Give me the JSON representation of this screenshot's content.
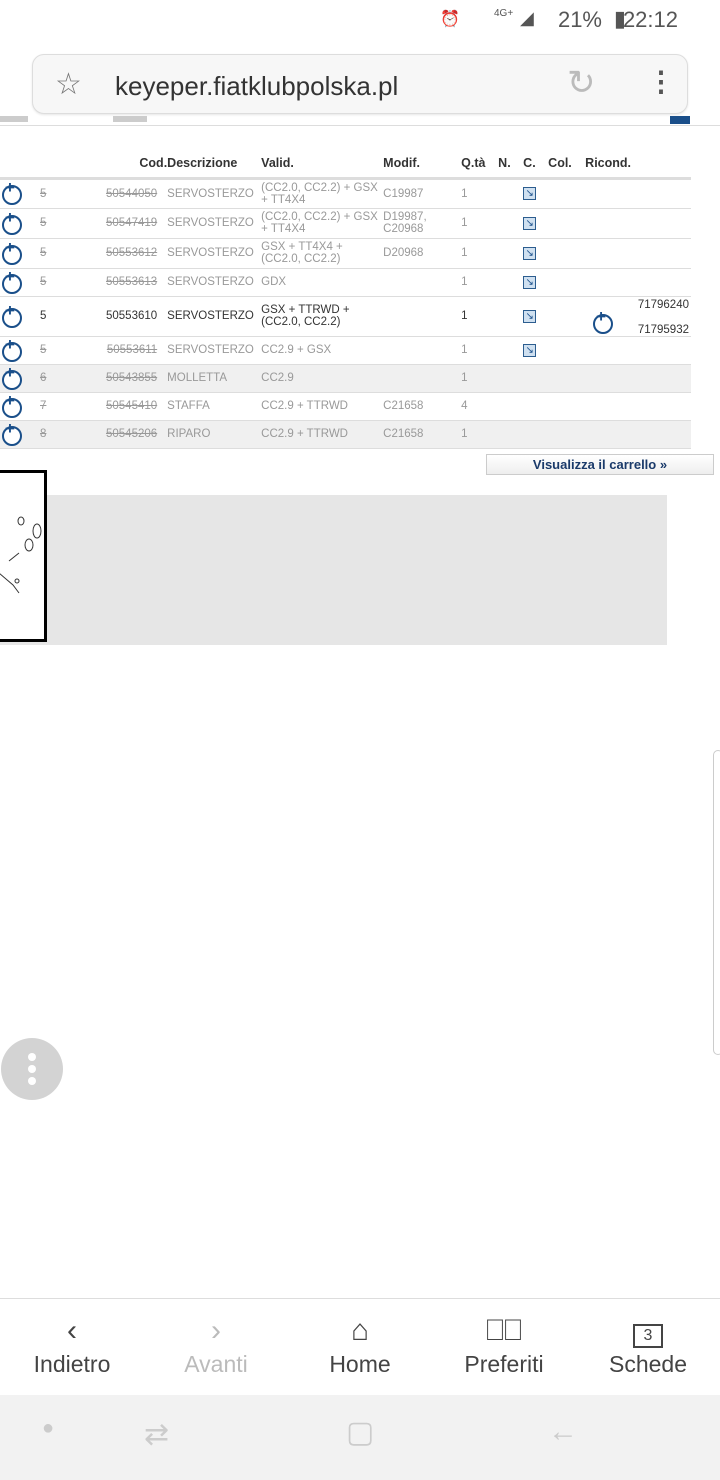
{
  "status": {
    "network": "4G+",
    "battery": "21%",
    "time": "22:12"
  },
  "browser": {
    "url": "keyeper.fiatklubpolska.pl"
  },
  "table": {
    "headers": [
      "",
      "",
      "Cod.",
      "Descrizione",
      "Valid.",
      "Modif.",
      "Q.tà",
      "N.",
      "C.",
      "Col.",
      "Ricond."
    ],
    "rows": [
      {
        "pos": "5",
        "cod": "50544050",
        "desc": "SERVOSTERZO",
        "valid": "(CC2.0, CC2.2) + GSX + TT4X4",
        "modif": "C19987",
        "qty": "1",
        "doc": true,
        "ricond": "",
        "obsolete": true
      },
      {
        "pos": "5",
        "cod": "50547419",
        "desc": "SERVOSTERZO",
        "valid": "(CC2.0, CC2.2) + GSX + TT4X4",
        "modif": "D19987, C20968",
        "qty": "1",
        "doc": true,
        "ricond": "",
        "obsolete": true
      },
      {
        "pos": "5",
        "cod": "50553612",
        "desc": "SERVOSTERZO",
        "valid": "GSX + TT4X4 + (CC2.0, CC2.2)",
        "modif": "D20968",
        "qty": "1",
        "doc": true,
        "ricond": "",
        "obsolete": true
      },
      {
        "pos": "5",
        "cod": "50553613",
        "desc": "SERVOSTERZO",
        "valid": "GDX",
        "modif": "",
        "qty": "1",
        "doc": true,
        "ricond": "",
        "obsolete": true
      },
      {
        "pos": "5",
        "cod": "50553610",
        "desc": "SERVOSTERZO",
        "valid": "GSX + TTRWD + (CC2.0, CC2.2)",
        "modif": "",
        "qty": "1",
        "doc": true,
        "ricond": [
          "71796240",
          "71795932"
        ],
        "obsolete": false
      },
      {
        "pos": "5",
        "cod": "50553611",
        "desc": "SERVOSTERZO",
        "valid": "CC2.9 + GSX",
        "modif": "",
        "qty": "1",
        "doc": true,
        "ricond": "",
        "obsolete": true
      },
      {
        "pos": "6",
        "cod": "50543855",
        "desc": "MOLLETTA",
        "valid": "CC2.9",
        "modif": "",
        "qty": "1",
        "doc": false,
        "ricond": "",
        "obsolete": true
      },
      {
        "pos": "7",
        "cod": "50545410",
        "desc": "STAFFA",
        "valid": "CC2.9 + TTRWD",
        "modif": "C21658",
        "qty": "4",
        "doc": false,
        "ricond": "",
        "obsolete": true
      },
      {
        "pos": "8",
        "cod": "50545206",
        "desc": "RIPARO",
        "valid": "CC2.9 + TTRWD",
        "modif": "C21658",
        "qty": "1",
        "doc": false,
        "ricond": "",
        "obsolete": true
      }
    ]
  },
  "cart_button": "Visualizza il carrello »",
  "bottom_nav": [
    {
      "label": "Indietro",
      "icon": "chevron-left-icon"
    },
    {
      "label": "Avanti",
      "icon": "chevron-right-icon",
      "disabled": true
    },
    {
      "label": "Home",
      "icon": "home-icon"
    },
    {
      "label": "Preferiti",
      "icon": "bookmarks-icon"
    },
    {
      "label": "Schede",
      "icon": "tabs-icon",
      "count": "3"
    }
  ],
  "colors": {
    "accent": "#1a4f8a"
  }
}
